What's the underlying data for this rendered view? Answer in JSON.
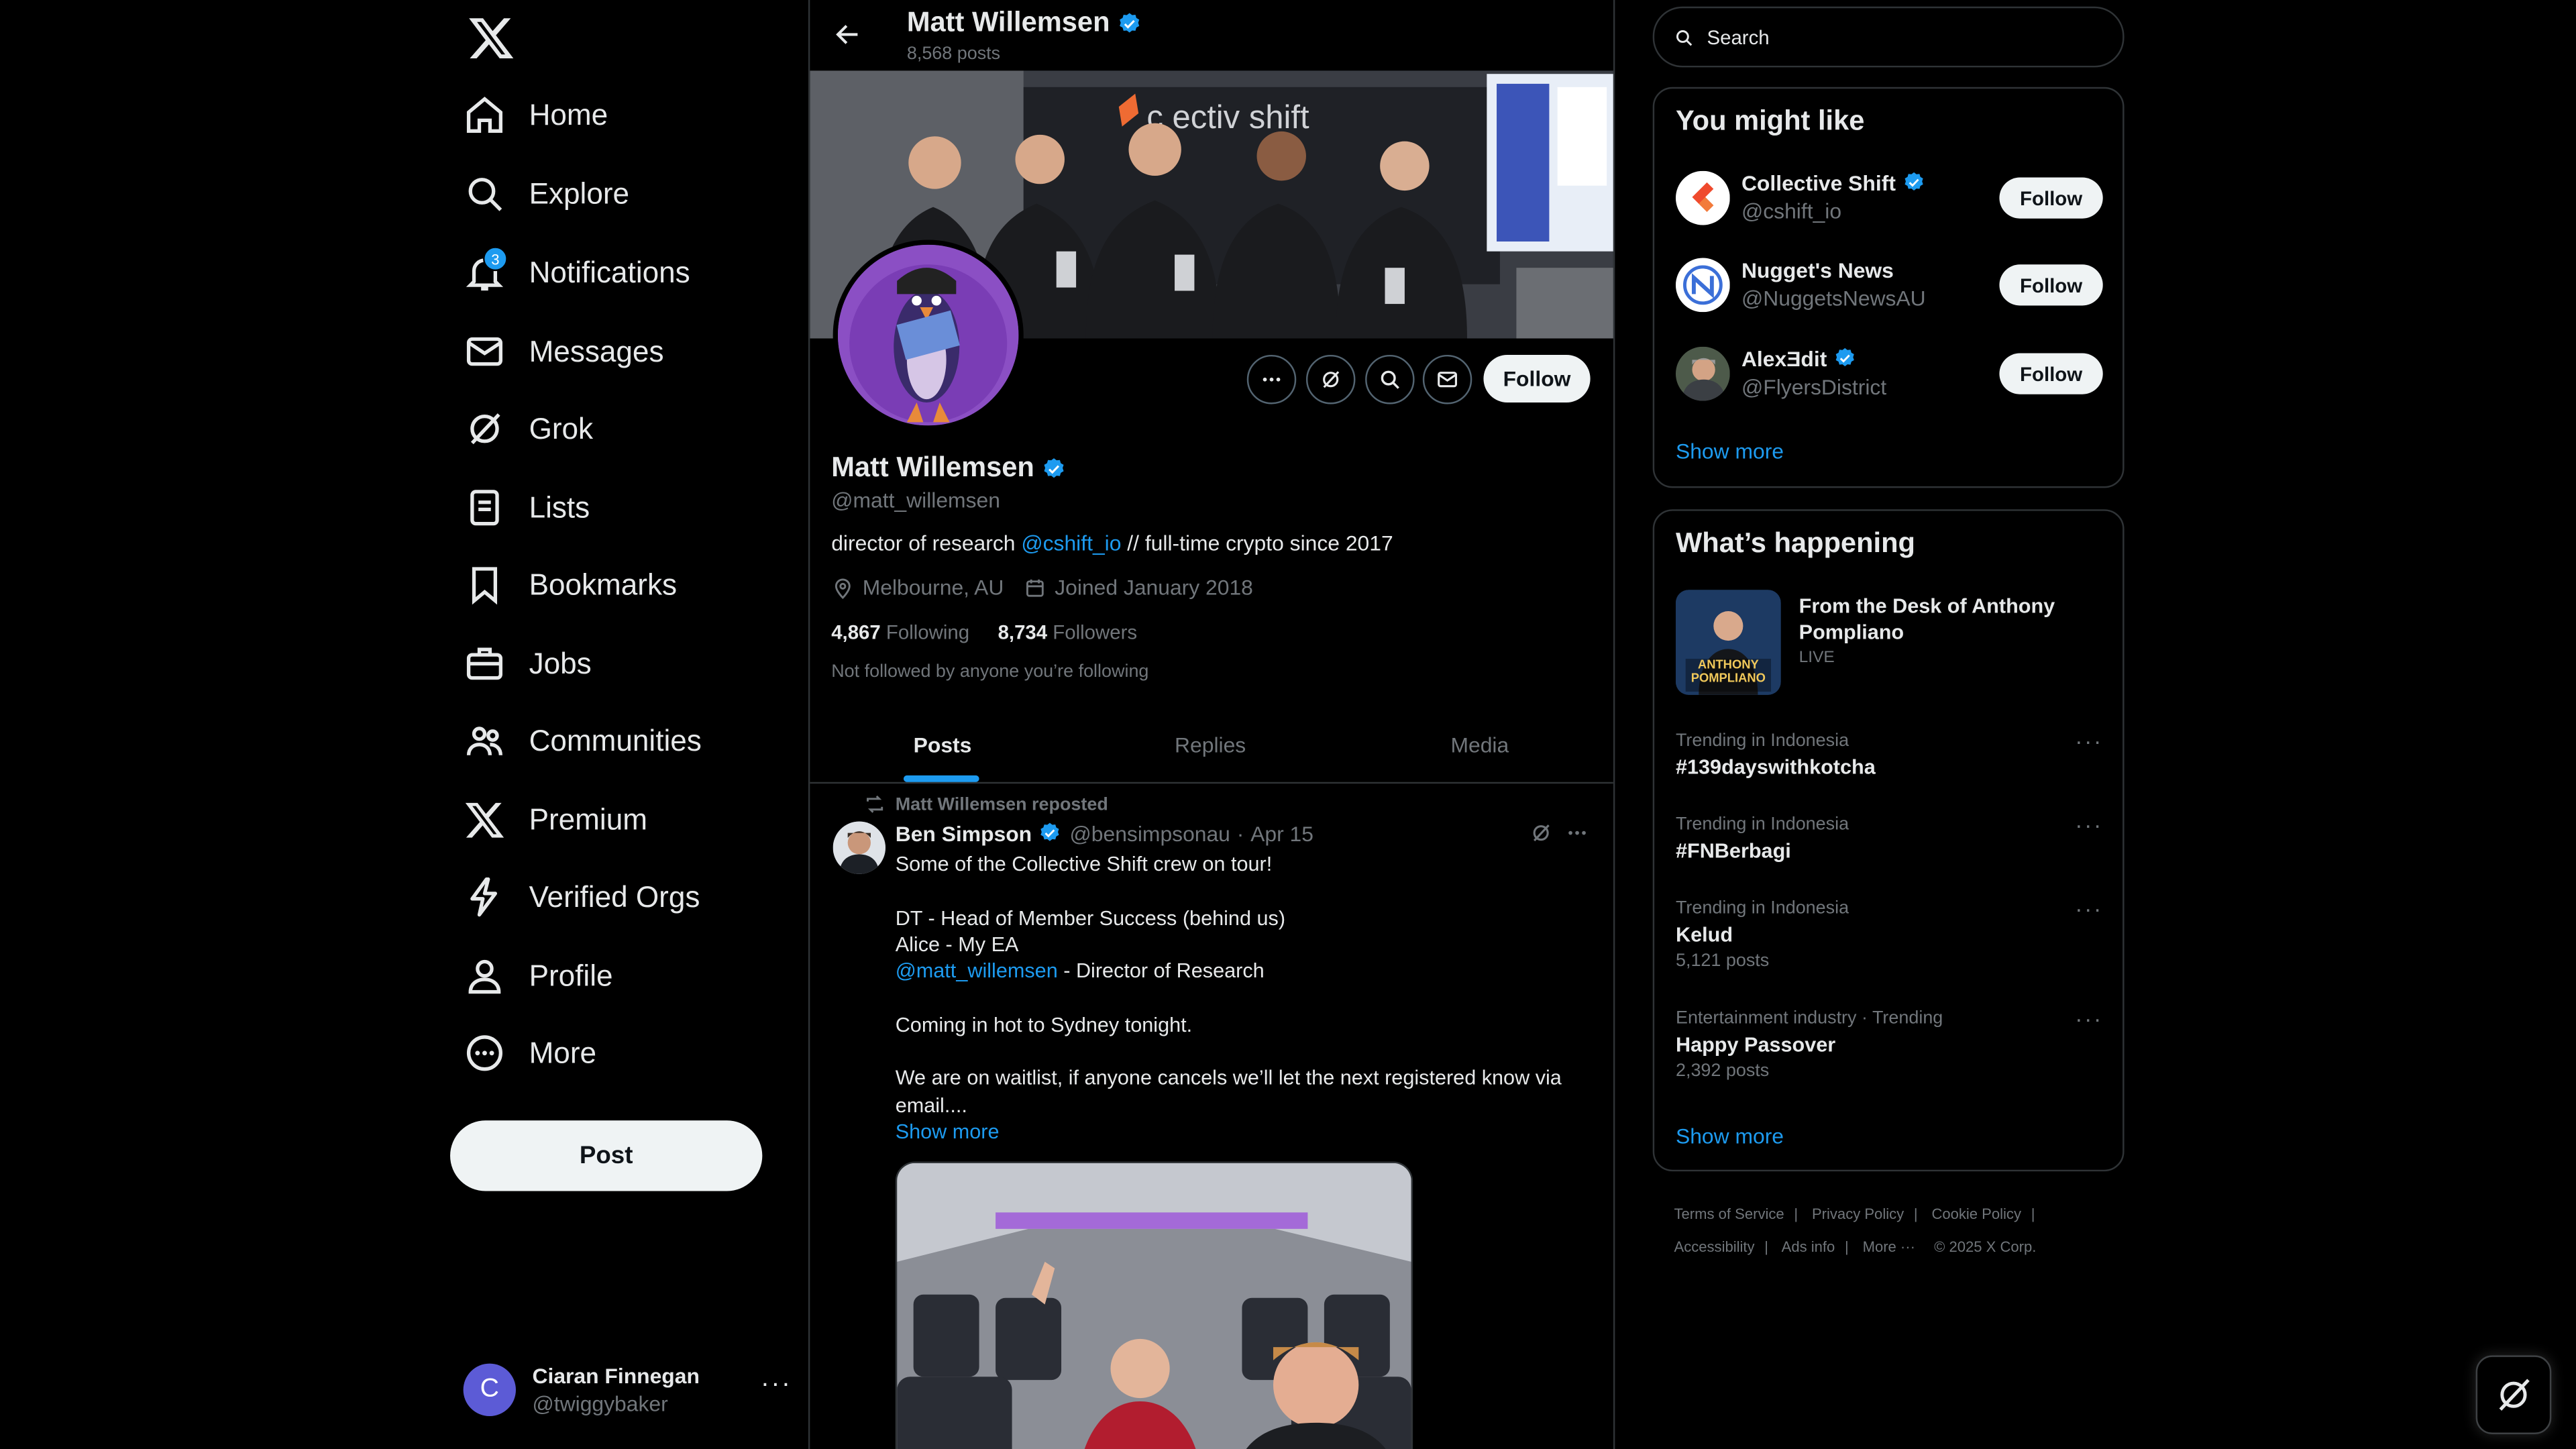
{
  "nav": {
    "items": [
      {
        "label": "Home",
        "icon": "home-icon"
      },
      {
        "label": "Explore",
        "icon": "search-icon"
      },
      {
        "label": "Notifications",
        "icon": "bell-icon",
        "badge": "3"
      },
      {
        "label": "Messages",
        "icon": "mail-icon"
      },
      {
        "label": "Grok",
        "icon": "grok-icon"
      },
      {
        "label": "Lists",
        "icon": "list-icon"
      },
      {
        "label": "Bookmarks",
        "icon": "bookmark-icon"
      },
      {
        "label": "Jobs",
        "icon": "briefcase-icon"
      },
      {
        "label": "Communities",
        "icon": "people-icon"
      },
      {
        "label": "Premium",
        "icon": "x-logo-icon"
      },
      {
        "label": "Verified Orgs",
        "icon": "lightning-icon"
      },
      {
        "label": "Profile",
        "icon": "person-icon"
      },
      {
        "label": "More",
        "icon": "more-circle-icon"
      }
    ],
    "post_label": "Post",
    "account": {
      "initial": "C",
      "name": "Ciaran Finnegan",
      "handle": "@twiggybaker",
      "more": "···"
    }
  },
  "profile": {
    "topbar_name": "Matt Willemsen",
    "post_count": "8,568 posts",
    "name": "Matt Willemsen",
    "handle": "@matt_willemsen",
    "bio_prefix": "director of research ",
    "bio_link": "@cshift_io",
    "bio_suffix": " // full-time crypto since 2017",
    "location": "Melbourne, AU",
    "joined": "Joined January 2018",
    "following_count": "4,867",
    "following_label": "Following",
    "followers_count": "8,734",
    "followers_label": "Followers",
    "not_followed": "Not followed by anyone you’re following",
    "follow_label": "Follow",
    "tabs": [
      "Posts",
      "Replies",
      "Media"
    ]
  },
  "tweet": {
    "repost_label": "Matt Willemsen reposted",
    "author": "Ben Simpson",
    "handle": "@bensimpsonau",
    "dot": "·",
    "date": "Apr 15",
    "line1": "Some of the Collective Shift crew on tour!",
    "line2": "DT - Head of Member Success (behind us)",
    "line3": "Alice - My EA",
    "mention": "@matt_willemsen",
    "line4_suffix": " - Director of Research",
    "line5": "Coming in hot to Sydney tonight.",
    "line6": "We are on waitlist, if anyone cancels we’ll let the next registered know via email....",
    "show_more": "Show more"
  },
  "right": {
    "search_placeholder": "Search",
    "wtf_title": "You might like",
    "suggestions": [
      {
        "name": "Collective Shift",
        "handle": "@cshift_io",
        "follow": "Follow"
      },
      {
        "name": "Nugget's News",
        "handle": "@NuggetsNewsAU",
        "follow": "Follow"
      },
      {
        "name": "AlexƎdit",
        "handle": "@FlyersDistrict",
        "follow": "Follow"
      }
    ],
    "wtf_show_more": "Show more",
    "happening_title": "What’s happening",
    "live": {
      "title": "From the Desk of Anthony Pompliano",
      "status": "LIVE",
      "thumb_text": "ANTHONY POMPLIANO"
    },
    "trends": [
      {
        "context": "Trending in Indonesia",
        "topic": "#139dayswithkotcha",
        "count": ""
      },
      {
        "context": "Trending in Indonesia",
        "topic": "#FNBerbagi",
        "count": ""
      },
      {
        "context": "Trending in Indonesia",
        "topic": "Kelud",
        "count": "5,121 posts"
      },
      {
        "context": "Entertainment industry · Trending",
        "topic": "Happy Passover",
        "count": "2,392 posts"
      }
    ],
    "happening_show_more": "Show more",
    "footer": {
      "terms": "Terms of Service",
      "privacy": "Privacy Policy",
      "cookie": "Cookie Policy",
      "accessibility": "Accessibility",
      "ads": "Ads info",
      "more": "More ···",
      "copyright": "© 2025 X Corp.",
      "sep": "|"
    }
  },
  "colors": {
    "accent": "#1d9bf0",
    "background": "#000000",
    "border": "#2f3336",
    "muted": "#71767b"
  }
}
